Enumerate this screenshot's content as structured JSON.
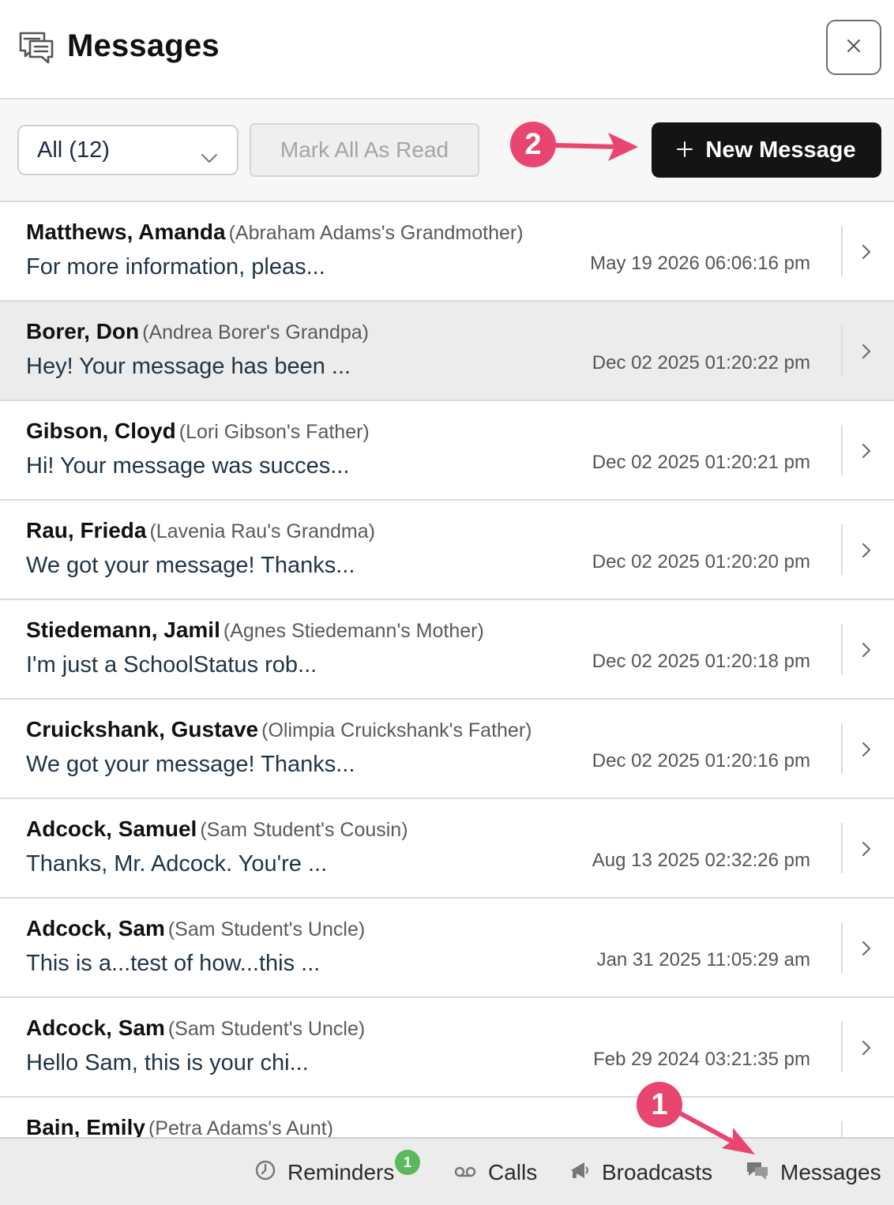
{
  "header": {
    "title": "Messages"
  },
  "toolbar": {
    "filter_value": "All (12)",
    "mark_all_read_label": "Mark All As Read",
    "new_message_label": "New Message"
  },
  "annotations": {
    "marker_1": "1",
    "marker_2": "2",
    "color": "#e8456f"
  },
  "messages": [
    {
      "name": "Matthews, Amanda",
      "relation": "(Abraham Adams's Grandmother)",
      "preview": "For more information, pleas...",
      "time": "May 19 2026 06:06:16 pm"
    },
    {
      "name": "Borer, Don",
      "relation": "(Andrea Borer's Grandpa)",
      "preview": "Hey! Your message has been ...",
      "time": "Dec 02 2025 01:20:22 pm"
    },
    {
      "name": "Gibson, Cloyd",
      "relation": "(Lori Gibson's Father)",
      "preview": "Hi! Your message was succes...",
      "time": "Dec 02 2025 01:20:21 pm"
    },
    {
      "name": "Rau, Frieda",
      "relation": "(Lavenia Rau's Grandma)",
      "preview": "We got your message! Thanks...",
      "time": "Dec 02 2025 01:20:20 pm"
    },
    {
      "name": "Stiedemann, Jamil",
      "relation": "(Agnes Stiedemann's Mother)",
      "preview": "I'm just a SchoolStatus rob...",
      "time": "Dec 02 2025 01:20:18 pm"
    },
    {
      "name": "Cruickshank, Gustave",
      "relation": "(Olimpia Cruickshank's Father)",
      "preview": "We got your message! Thanks...",
      "time": "Dec 02 2025 01:20:16 pm"
    },
    {
      "name": "Adcock, Samuel",
      "relation": "(Sam Student's Cousin)",
      "preview": "Thanks, Mr. Adcock. You're ...",
      "time": "Aug 13 2025 02:32:26 pm"
    },
    {
      "name": "Adcock, Sam",
      "relation": "(Sam Student's Uncle)",
      "preview": "This is a...test of how...this ...",
      "time": "Jan 31 2025 11:05:29 am"
    },
    {
      "name": "Adcock, Sam",
      "relation": "(Sam Student's Uncle)",
      "preview": "Hello Sam, this is your chi...",
      "time": "Feb 29 2024 03:21:35 pm"
    },
    {
      "name": "Bain, Emily",
      "relation": "(Petra Adams's Aunt)",
      "preview": "",
      "time": ""
    }
  ],
  "bottom_nav": {
    "reminders_label": "Reminders",
    "reminders_badge": "1",
    "calls_label": "Calls",
    "broadcasts_label": "Broadcasts",
    "messages_label": "Messages"
  },
  "icons": [
    "messages-icon",
    "close-icon",
    "chevron-down-icon",
    "plus-icon",
    "chevron-right-icon",
    "clock-icon",
    "voicemail-icon",
    "megaphone-icon",
    "chat-bubbles-icon"
  ]
}
